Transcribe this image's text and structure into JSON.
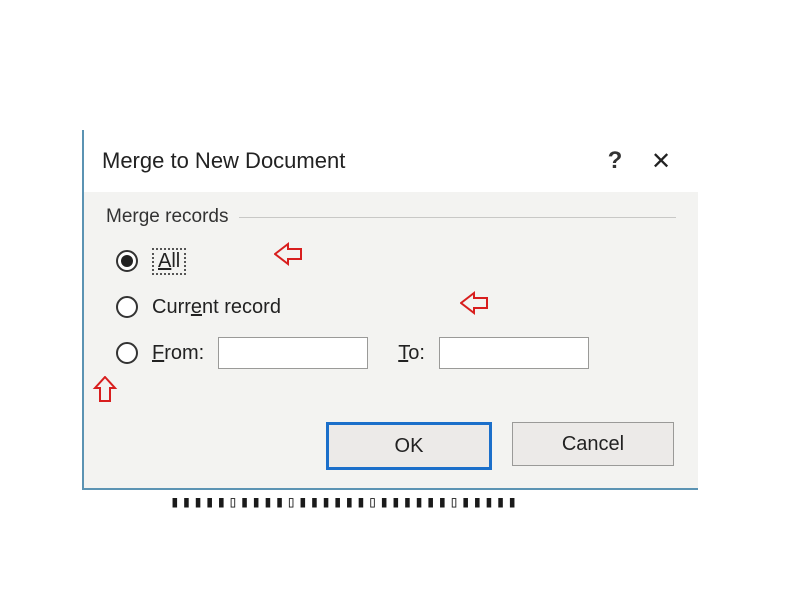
{
  "dialog": {
    "title": "Merge to New Document",
    "group_label": "Merge records",
    "options": {
      "all_pre": "",
      "all_u": "A",
      "all_post": "ll",
      "current_pre": "Curr",
      "current_u": "e",
      "current_post": "nt record",
      "from_pre": "",
      "from_u": "F",
      "from_post": "rom:",
      "to_pre": "",
      "to_u": "T",
      "to_post": "o:",
      "from_value": "",
      "to_value": ""
    },
    "buttons": {
      "ok": "OK",
      "cancel": "Cancel"
    }
  },
  "titlebar_help": "?",
  "titlebar_close": "✕"
}
